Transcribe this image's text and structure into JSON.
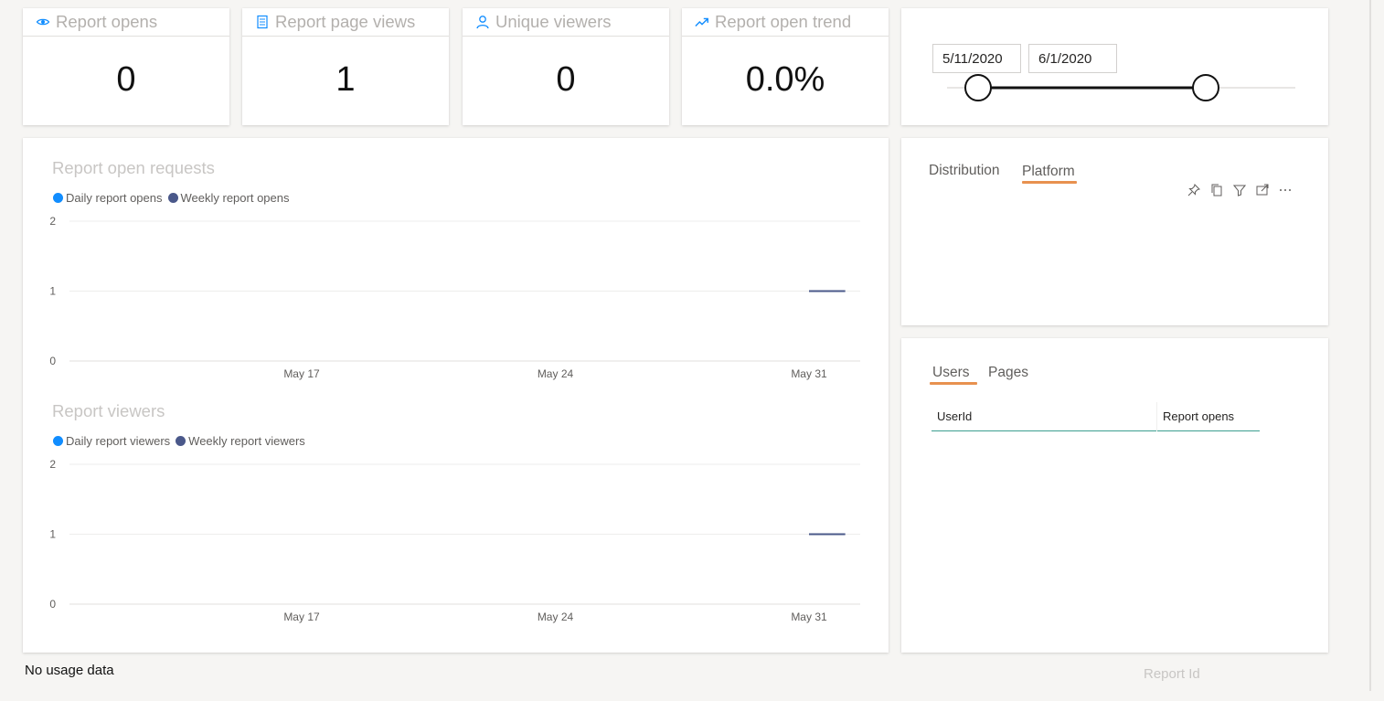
{
  "kpis": [
    {
      "title": "Report opens",
      "value": "0",
      "icon": "eye-icon"
    },
    {
      "title": "Report page views",
      "value": "1",
      "icon": "page-icon"
    },
    {
      "title": "Unique viewers",
      "value": "0",
      "icon": "person-icon"
    },
    {
      "title": "Report open trend",
      "value": "0.0%",
      "icon": "trend-up-icon"
    }
  ],
  "date_slicer": {
    "start": "5/11/2020",
    "end": "6/1/2020"
  },
  "charts": {
    "requests": {
      "title": "Report open requests",
      "legend": [
        "Daily report opens",
        "Weekly report opens"
      ]
    },
    "viewers": {
      "title": "Report viewers",
      "legend": [
        "Daily report viewers",
        "Weekly report viewers"
      ]
    },
    "y_ticks": [
      "2",
      "1",
      "0"
    ],
    "x_ticks": [
      "May 17",
      "May 24",
      "May 31"
    ]
  },
  "chart_data": [
    {
      "type": "line",
      "title": "Report open requests",
      "x": [
        "May 31",
        "Jun 1"
      ],
      "series": [
        {
          "name": "Daily report opens",
          "values": []
        },
        {
          "name": "Weekly report opens",
          "values": [
            1,
            1
          ]
        }
      ],
      "ylim": [
        0,
        2
      ],
      "x_ticks": [
        "May 17",
        "May 24",
        "May 31"
      ]
    },
    {
      "type": "line",
      "title": "Report viewers",
      "x": [
        "May 31",
        "Jun 1"
      ],
      "series": [
        {
          "name": "Daily report viewers",
          "values": []
        },
        {
          "name": "Weekly report viewers",
          "values": [
            1,
            1
          ]
        }
      ],
      "ylim": [
        0,
        2
      ],
      "x_ticks": [
        "May 17",
        "May 24",
        "May 31"
      ]
    }
  ],
  "colors": {
    "daily": "#118dff",
    "weekly": "#4a588a",
    "accent": "#e8914f",
    "table_rule": "#3c9e8f"
  },
  "dist_tabs": [
    "Distribution",
    "Platform"
  ],
  "user_tabs": [
    "Users",
    "Pages"
  ],
  "table": {
    "headers": [
      "UserId",
      "Report opens"
    ]
  },
  "footer": {
    "no_data": "No usage data",
    "report_id_label": "Report Id"
  }
}
